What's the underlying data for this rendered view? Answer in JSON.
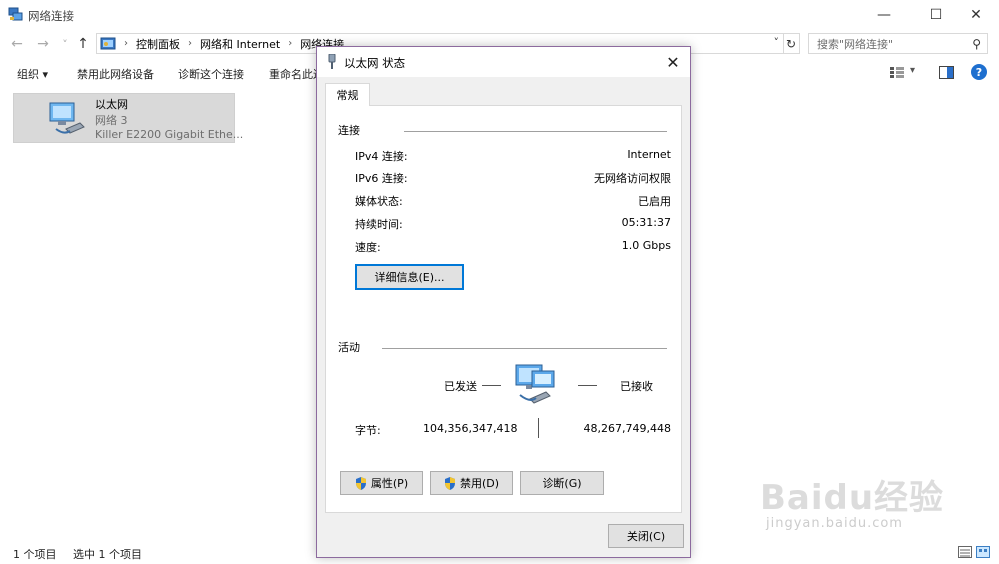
{
  "explorer": {
    "title": "网络连接",
    "window_controls": {
      "minimize": "—",
      "maximize": "☐",
      "close": "✕"
    },
    "nav": {
      "back": "←",
      "forward": "→",
      "recent": "˅",
      "up": "↑"
    },
    "breadcrumb": [
      "控制面板",
      "网络和 Internet",
      "网络连接"
    ],
    "breadcrumb_sep": "›",
    "address_dropdown": "˅",
    "refresh": "↻",
    "search": {
      "placeholder": "搜索\"网络连接\"",
      "icon": "⚲"
    },
    "toolbar": {
      "organize": "组织 ▾",
      "disable": "禁用此网络设备",
      "diagnose": "诊断这个连接",
      "rename": "重命名此连"
    },
    "view_icons": {
      "view_options": "▾",
      "help": "?"
    },
    "item": {
      "name": "以太网",
      "network": "网络 3",
      "adapter": "Killer E2200 Gigabit Ethe..."
    },
    "status": {
      "count": "1 个项目",
      "selected": "选中 1 个项目"
    }
  },
  "dialog": {
    "title": "以太网 状态",
    "close": "✕",
    "tab": "常规",
    "connection": {
      "header": "连接",
      "rows": [
        {
          "label": "IPv4 连接:",
          "value": "Internet"
        },
        {
          "label": "IPv6 连接:",
          "value": "无网络访问权限"
        },
        {
          "label": "媒体状态:",
          "value": "已启用"
        },
        {
          "label": "持续时间:",
          "value": "05:31:37"
        },
        {
          "label": "速度:",
          "value": "1.0 Gbps"
        }
      ],
      "details_button": "详细信息(E)..."
    },
    "activity": {
      "header": "活动",
      "sent": "已发送",
      "received": "已接收",
      "bytes_label": "字节:",
      "bytes_sent": "104,356,347,418",
      "bytes_received": "48,267,749,448"
    },
    "buttons": {
      "properties": "属性(P)",
      "disable": "禁用(D)",
      "diagnose": "诊断(G)",
      "close": "关闭(C)"
    }
  },
  "watermark": {
    "brand": "Baidu经验",
    "url": "jingyan.baidu.com"
  },
  "colors": {
    "selection": "#d9d9d9",
    "dialog_border": "#8c6a9e",
    "focus": "#0078d7",
    "help": "#1e6fcf"
  }
}
